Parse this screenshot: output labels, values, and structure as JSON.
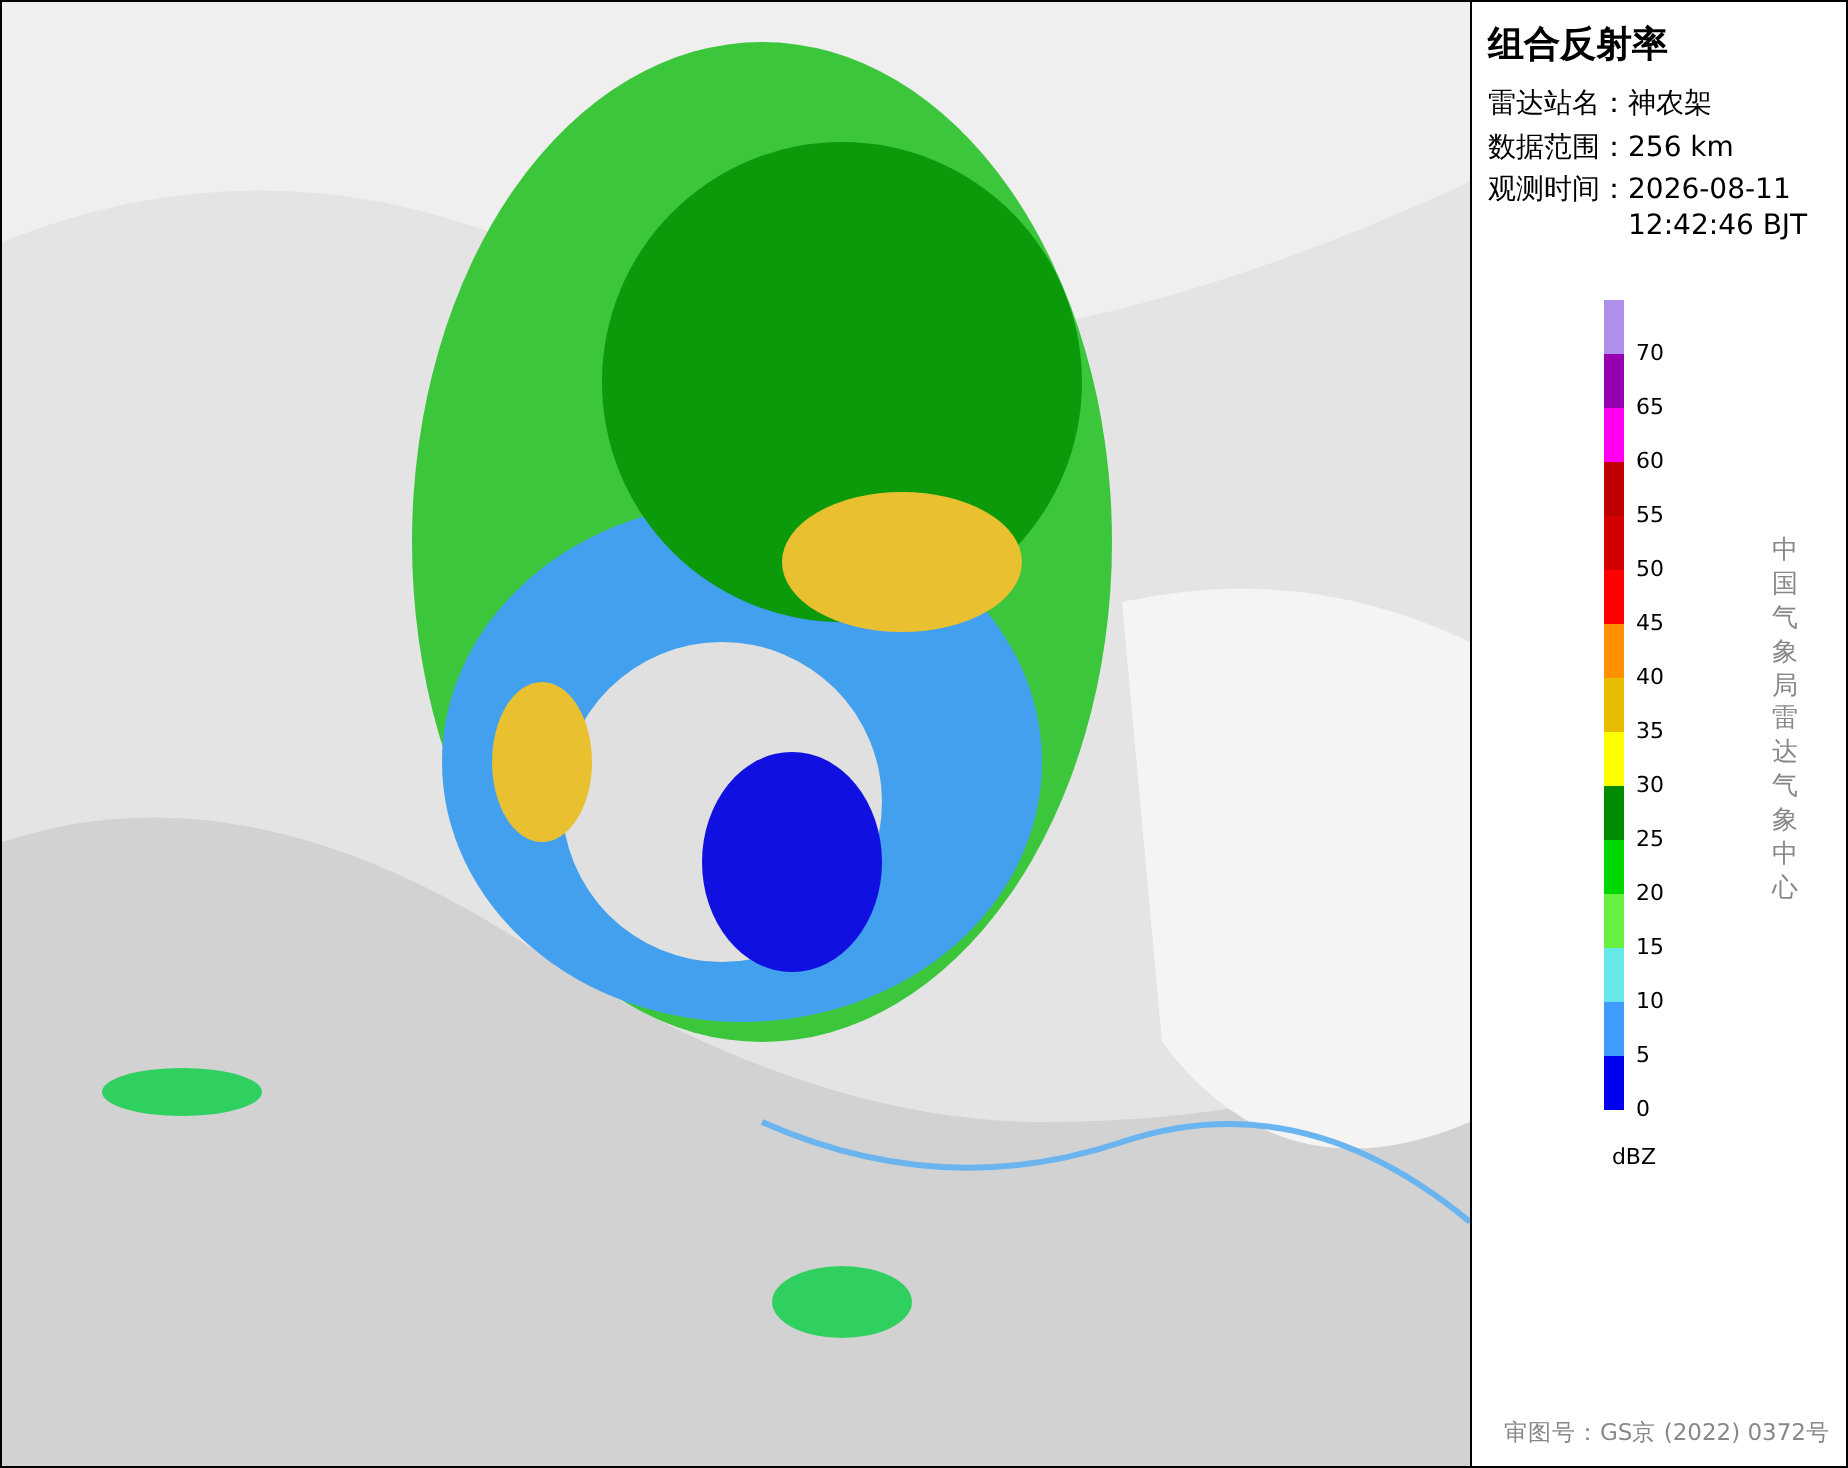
{
  "panel": {
    "title": "组合反射率",
    "info": [
      {
        "label": "雷达站名：",
        "value": "神农架"
      },
      {
        "label": "数据范围：",
        "value": "256 km"
      },
      {
        "label": "观测时间：",
        "value": "2026-08-11 12:42:46 BJT"
      }
    ],
    "legend": {
      "entries": [
        {
          "color": "#ae90ec",
          "label": "70"
        },
        {
          "color": "#9600b0",
          "label": "65"
        },
        {
          "color": "#ff00f0",
          "label": "60"
        },
        {
          "color": "#c00000",
          "label": "55"
        },
        {
          "color": "#d40000",
          "label": "50"
        },
        {
          "color": "#ff0000",
          "label": "45"
        },
        {
          "color": "#ff9000",
          "label": "40"
        },
        {
          "color": "#e8bc00",
          "label": "35"
        },
        {
          "color": "#ffff00",
          "label": "30"
        },
        {
          "color": "#008c00",
          "label": "25"
        },
        {
          "color": "#00d800",
          "label": "20"
        },
        {
          "color": "#66f040",
          "label": "15"
        },
        {
          "color": "#66e8e8",
          "label": "10"
        },
        {
          "color": "#409cff",
          "label": "5"
        },
        {
          "color": "#0000f0",
          "label": "0"
        }
      ],
      "unit": "dBZ"
    },
    "credit": "中国气象局雷达气象中心",
    "approval": "审图号：GS京 (2022) 0372号"
  }
}
